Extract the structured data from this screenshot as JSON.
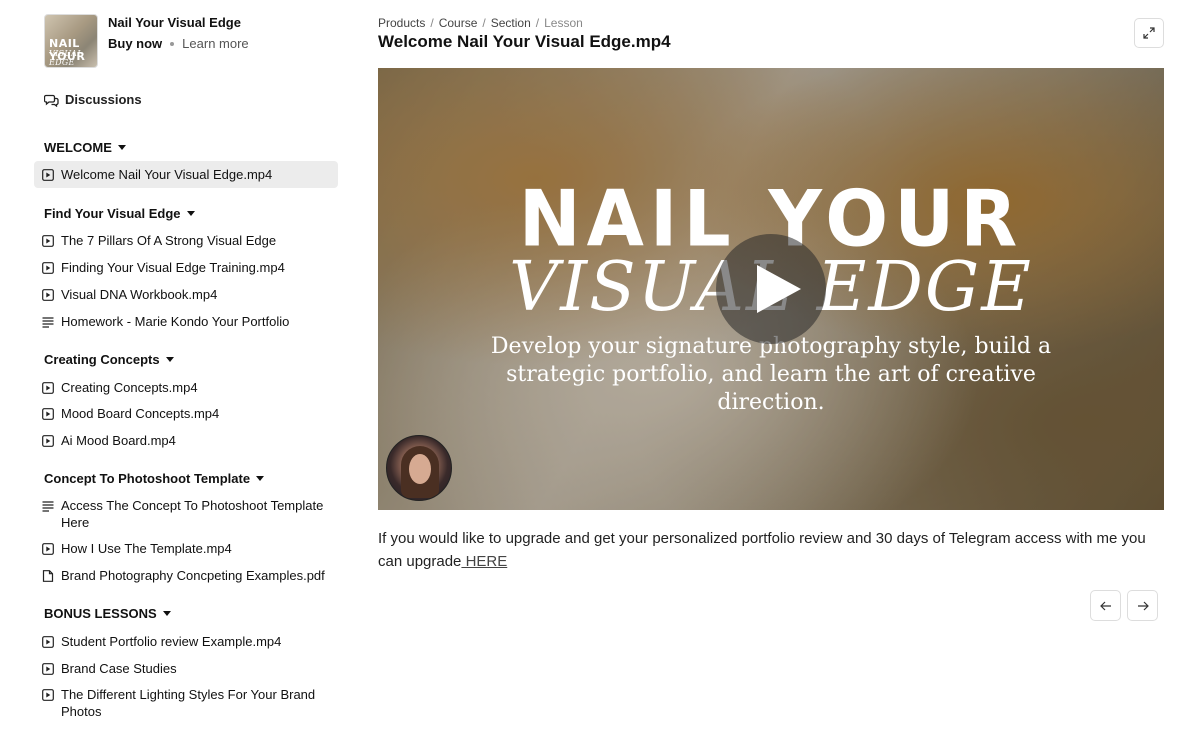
{
  "product": {
    "title": "Nail Your Visual Edge",
    "buy_label": "Buy now",
    "learn_label": "Learn more",
    "thumb_line1": "NAIL YOUR",
    "thumb_line2": "VISUAL EDGE"
  },
  "discussions_label": "Discussions",
  "sections": [
    {
      "title": "WELCOME",
      "items": [
        {
          "label": "Welcome Nail Your Visual Edge.mp4",
          "icon": "video-icon",
          "active": true
        }
      ]
    },
    {
      "title": "Find Your Visual Edge",
      "items": [
        {
          "label": "The 7 Pillars Of A Strong Visual Edge",
          "icon": "video-icon"
        },
        {
          "label": "Finding Your Visual Edge Training.mp4",
          "icon": "video-icon"
        },
        {
          "label": "Visual DNA Workbook.mp4",
          "icon": "video-icon"
        },
        {
          "label": "Homework - Marie Kondo Your Portfolio",
          "icon": "text-lines-icon"
        }
      ]
    },
    {
      "title": "Creating Concepts",
      "items": [
        {
          "label": "Creating Concepts.mp4",
          "icon": "video-icon"
        },
        {
          "label": "Mood Board Concepts.mp4",
          "icon": "video-icon"
        },
        {
          "label": "Ai Mood Board.mp4",
          "icon": "video-icon"
        }
      ]
    },
    {
      "title": "Concept To Photoshoot Template",
      "items": [
        {
          "label": "Access The Concept To Photoshoot Template Here",
          "icon": "text-lines-icon"
        },
        {
          "label": "How I Use The Template.mp4",
          "icon": "video-icon"
        },
        {
          "label": "Brand Photography Concpeting Examples.pdf",
          "icon": "file-icon"
        }
      ]
    },
    {
      "title": "BONUS LESSONS",
      "items": [
        {
          "label": "Student Portfolio review Example.mp4",
          "icon": "video-icon"
        },
        {
          "label": "Brand Case Studies",
          "icon": "video-icon"
        },
        {
          "label": "The Different Lighting Styles For Your Brand Photos",
          "icon": "video-icon"
        }
      ]
    }
  ],
  "breadcrumb": [
    "Products",
    "Course",
    "Section",
    "Lesson"
  ],
  "lesson_title": "Welcome Nail Your Visual Edge.mp4",
  "video": {
    "line1": "NAIL YOUR",
    "line2": "VISUAL EDGE",
    "line3": "Develop your signature photography style, build a strategic portfolio, and learn the art of creative direction."
  },
  "description": {
    "text": "If you would like to upgrade and get your personalized portfolio review and 30 days of Telegram access with me you can upgrade",
    "link": " HERE"
  },
  "icons": {
    "expand": "expand-icon",
    "prev": "arrow-left-icon",
    "next": "arrow-right-icon",
    "discussions": "chat-bubbles-icon"
  }
}
